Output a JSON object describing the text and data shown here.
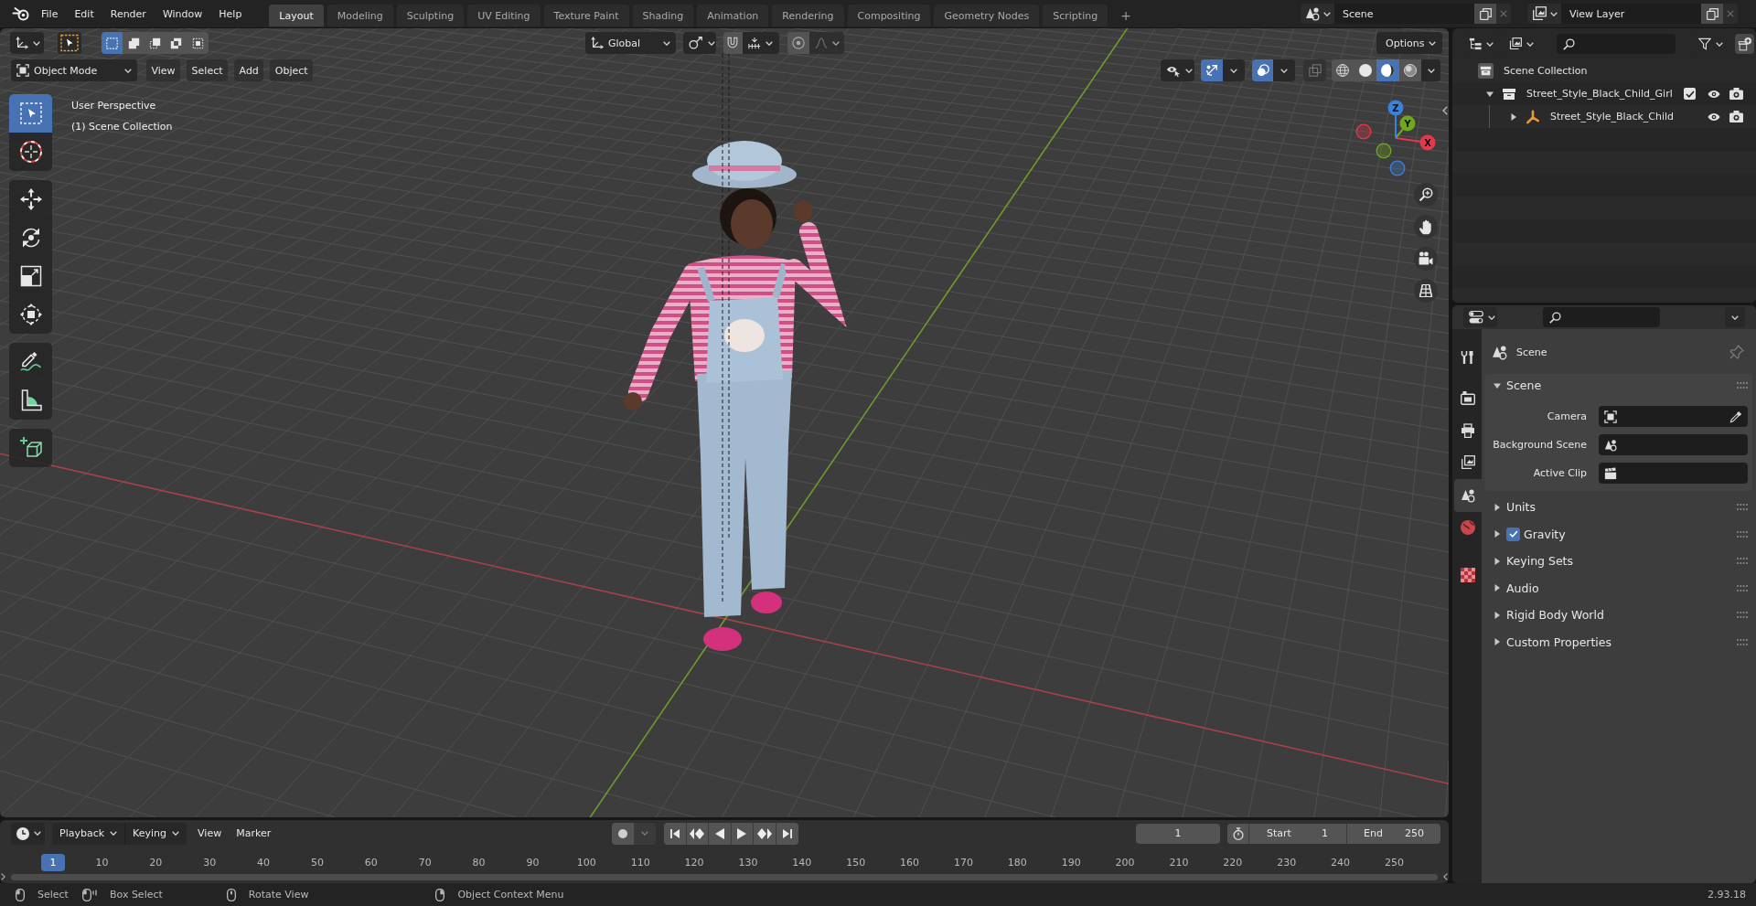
{
  "topbar": {
    "menus": [
      "File",
      "Edit",
      "Render",
      "Window",
      "Help"
    ],
    "workspaces": [
      {
        "label": "Layout",
        "selected": true
      },
      {
        "label": "Modeling",
        "selected": false
      },
      {
        "label": "Sculpting",
        "selected": false
      },
      {
        "label": "UV Editing",
        "selected": false
      },
      {
        "label": "Texture Paint",
        "selected": false
      },
      {
        "label": "Shading",
        "selected": false
      },
      {
        "label": "Animation",
        "selected": false
      },
      {
        "label": "Rendering",
        "selected": false
      },
      {
        "label": "Compositing",
        "selected": false
      },
      {
        "label": "Geometry Nodes",
        "selected": false
      },
      {
        "label": "Scripting",
        "selected": false
      }
    ],
    "add_tab": "+",
    "scene": "Scene",
    "view_layer": "View Layer"
  },
  "viewport": {
    "tool_header": {
      "select_modes": [
        {
          "kind": "set",
          "selected": true
        },
        {
          "kind": "extend",
          "selected": false
        },
        {
          "kind": "subtract",
          "selected": false
        },
        {
          "kind": "difference",
          "selected": false
        },
        {
          "kind": "intersect",
          "selected": false
        }
      ],
      "orientation": "Global",
      "snap_on": false,
      "proportional_on": false,
      "options": "Options"
    },
    "header": {
      "mode": "Object Mode",
      "menus": [
        "View",
        "Select",
        "Add",
        "Object"
      ],
      "gizmos_on": true,
      "overlays_on": true,
      "xray_on": false,
      "shading": [
        {
          "kind": "wireframe",
          "selected": false
        },
        {
          "kind": "solid",
          "selected": false
        },
        {
          "kind": "material",
          "selected": true
        },
        {
          "kind": "rendered",
          "selected": false
        }
      ]
    },
    "toolbar": [
      {
        "tools": [
          {
            "kind": "select",
            "selected": true
          },
          {
            "kind": "cursor",
            "selected": false
          }
        ]
      },
      {
        "tools": [
          {
            "kind": "move",
            "selected": false
          },
          {
            "kind": "rotate",
            "selected": false
          },
          {
            "kind": "scale",
            "selected": false
          },
          {
            "kind": "transform",
            "selected": false
          }
        ]
      },
      {
        "tools": [
          {
            "kind": "annotate",
            "selected": false
          },
          {
            "kind": "measure",
            "selected": false
          }
        ]
      },
      {
        "tools": [
          {
            "kind": "addcube",
            "selected": false
          }
        ]
      }
    ],
    "view_name": "User Perspective",
    "collection": "(1) Scene Collection",
    "gizmo_axes": [
      {
        "label": "X",
        "color": "#e5394b"
      },
      {
        "label": "Y",
        "color": "#70a81d"
      },
      {
        "label": "Z",
        "color": "#3c82db"
      }
    ]
  },
  "outliner": {
    "tree": [
      {
        "label": "Scene Collection",
        "kind": "scene",
        "children": [
          {
            "label": "Street_Style_Black_Child_Girl",
            "kind": "collection",
            "expanded": true,
            "included": true,
            "visible": true,
            "renderable": true,
            "children": [
              {
                "label": "Street_Style_Black_Child",
                "kind": "armature",
                "expanded": false,
                "visible": true,
                "renderable": true
              }
            ]
          }
        ]
      }
    ]
  },
  "properties": {
    "tab_groups": [
      {
        "tabs": [
          {
            "kind": "tool",
            "selected": false
          }
        ]
      },
      {
        "tabs": [
          {
            "kind": "render",
            "selected": false
          },
          {
            "kind": "output",
            "selected": false
          },
          {
            "kind": "viewlayer",
            "selected": false
          },
          {
            "kind": "scene",
            "selected": true
          },
          {
            "kind": "world",
            "selected": false
          }
        ]
      },
      {
        "tabs": [
          {
            "kind": "texture",
            "selected": false
          }
        ]
      }
    ],
    "context": "Scene",
    "panels": [
      {
        "title": "Scene",
        "expanded": true,
        "fields": [
          {
            "label": "Camera",
            "kind": "camera"
          },
          {
            "label": "Background Scene",
            "kind": "scene"
          },
          {
            "label": "Active Clip",
            "kind": "clip"
          }
        ]
      },
      {
        "title": "Units",
        "expanded": false
      },
      {
        "title": "Gravity",
        "expanded": false,
        "checked": true
      },
      {
        "title": "Keying Sets",
        "expanded": false
      },
      {
        "title": "Audio",
        "expanded": false
      },
      {
        "title": "Rigid Body World",
        "expanded": false
      },
      {
        "title": "Custom Properties",
        "expanded": false
      }
    ]
  },
  "timeline": {
    "menus": [
      {
        "label": "Playback",
        "kind": "dropdown"
      },
      {
        "label": "Keying",
        "kind": "dropdown"
      },
      {
        "label": "View",
        "kind": "menu"
      },
      {
        "label": "Marker",
        "kind": "menu"
      }
    ],
    "auto_keying": false,
    "frame": "1",
    "start_label": "Start",
    "start": "1",
    "end_label": "End",
    "end": "250",
    "ruler_current": "1",
    "ruler_ticks": [
      "10",
      "20",
      "30",
      "40",
      "50",
      "60",
      "70",
      "80",
      "90",
      "100",
      "110",
      "120",
      "130",
      "140",
      "150",
      "160",
      "170",
      "180",
      "190",
      "200",
      "210",
      "220",
      "230",
      "240",
      "250"
    ]
  },
  "status_bar": {
    "hints": [
      {
        "label": "Select",
        "kind": "left"
      },
      {
        "label": "Box Select",
        "kind": "drag"
      },
      {
        "label": "Rotate View",
        "kind": "middle"
      },
      {
        "label": "Object Context Menu",
        "kind": "right"
      }
    ],
    "version": "2.93.18"
  }
}
